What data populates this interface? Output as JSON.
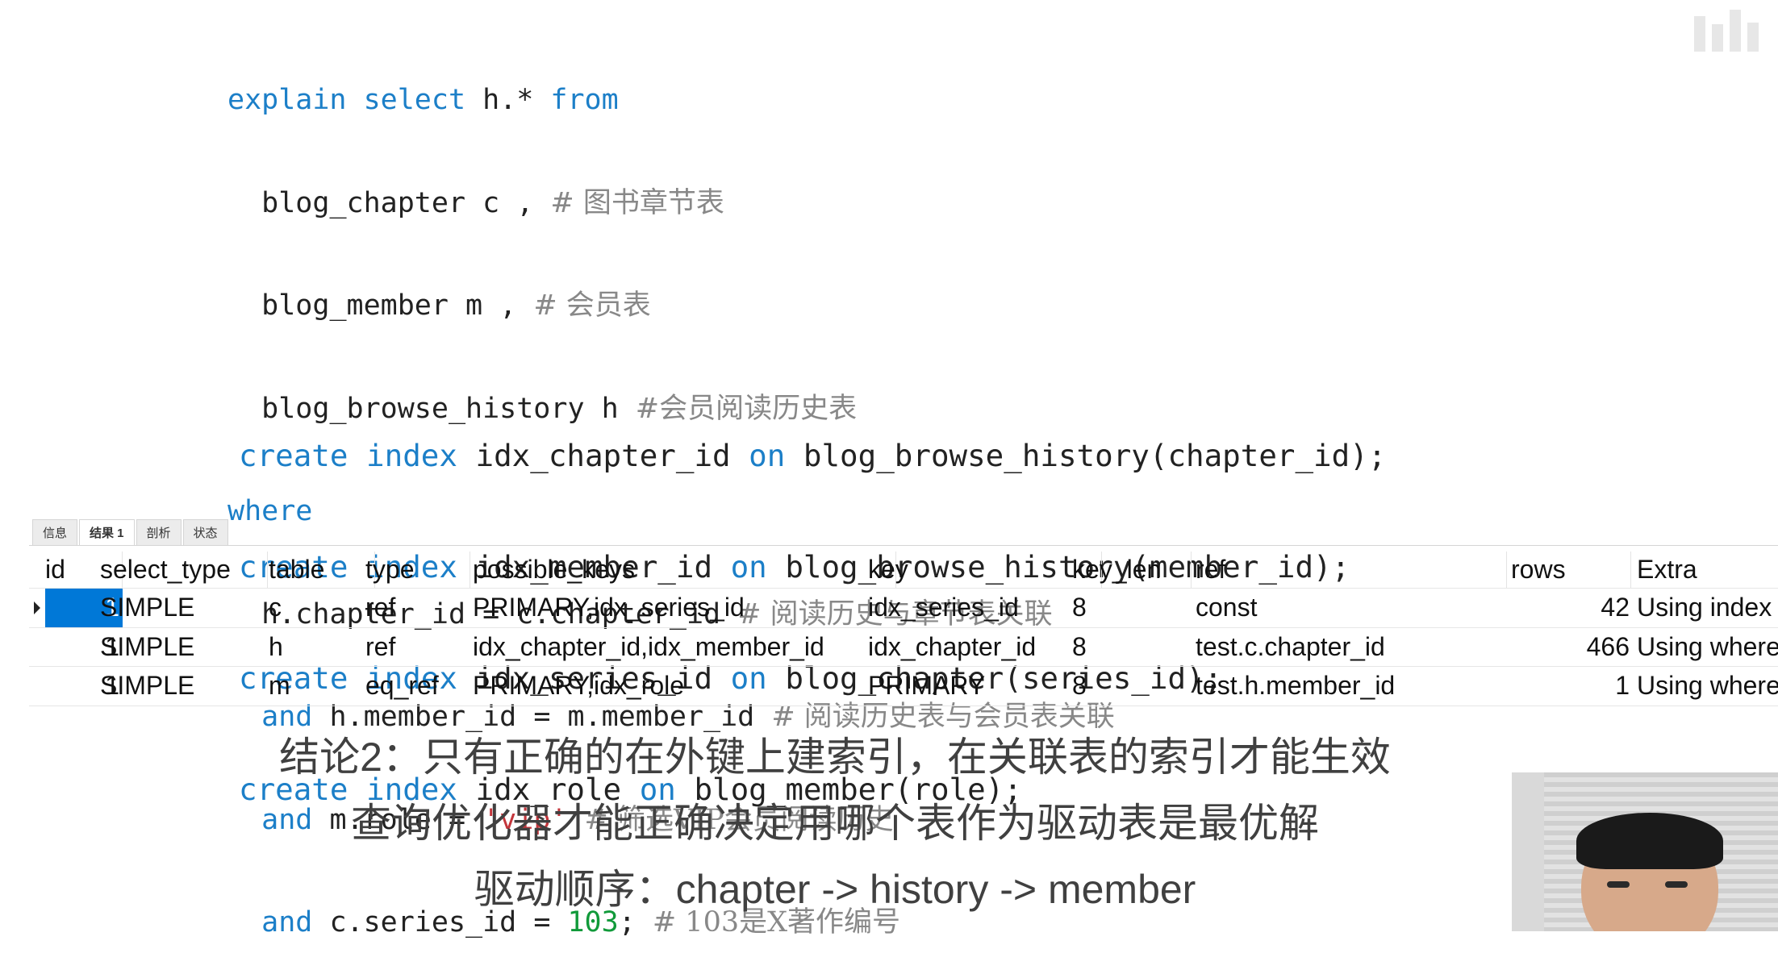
{
  "sql_explain": {
    "l1_kw1": "explain",
    "l1_kw2": "select",
    "l1_t1": "h.*",
    "l1_kw3": "from",
    "l2_code": "blog_chapter c ,",
    "l2_comment": "# 图书章节表",
    "l3_code": "blog_member m ,",
    "l3_comment": "# 会员表",
    "l4_code": "blog_browse_history h",
    "l4_comment": "#会员阅读历史表",
    "l5_kw": "where",
    "l6_code": "h.chapter_id = c.chapter_id",
    "l6_comment": "# 阅读历史与章节表关联",
    "l7_kw": "and",
    "l7_code": "h.member_id = m.member_id",
    "l7_comment": "# 阅读历史表与会员表关联",
    "l8_kw": "and",
    "l8_code": "m.role =",
    "l8_str": "'vip'",
    "l8_comment": "# 筛选VIP会员阅读历史",
    "l9_kw": "and",
    "l9_code": "c.series_id =",
    "l9_num": "103",
    "l9_semi": ";",
    "l9_comment": "# 103是X著作编号"
  },
  "sql_index": {
    "kw_create": "create",
    "kw_index": "index",
    "kw_on": "on",
    "lines": [
      {
        "name": "idx_chapter_id",
        "target": "blog_browse_history(chapter_id);"
      },
      {
        "name": "idx_member_id",
        "target": "blog_browse_history(member_id);"
      },
      {
        "name": "idx_series_id",
        "target": "blog_chapter(series_id);"
      },
      {
        "name": "idx_role",
        "target": "blog_member(role);"
      }
    ]
  },
  "tabs": [
    "信息",
    "结果 1",
    "剖析",
    "状态"
  ],
  "result": {
    "headers": {
      "id": "id",
      "select_type": "select_type",
      "table": "table",
      "type": "type",
      "possible_keys": "possible_keys",
      "key": "key",
      "key_len": "key_len",
      "ref": "ref",
      "rows": "rows",
      "extra": "Extra"
    },
    "rows": [
      {
        "id": "1",
        "select_type": "SIMPLE",
        "table": "c",
        "type": "ref",
        "possible_keys": "PRIMARY,idx_series_id",
        "key": "idx_series_id",
        "key_len": "8",
        "ref": "const",
        "rows": "42",
        "extra": "Using index"
      },
      {
        "id": "1",
        "select_type": "SIMPLE",
        "table": "h",
        "type": "ref",
        "possible_keys": "idx_chapter_id,idx_member_id",
        "key": "idx_chapter_id",
        "key_len": "8",
        "ref": "test.c.chapter_id",
        "rows": "466",
        "extra": "Using where"
      },
      {
        "id": "1",
        "select_type": "SIMPLE",
        "table": "m",
        "type": "eq_ref",
        "possible_keys": "PRIMARY,idx_role",
        "key": "PRIMARY",
        "key_len": "8",
        "ref": "test.h.member_id",
        "rows": "1",
        "extra": "Using where"
      }
    ]
  },
  "conclusion": {
    "line1": "结论2：只有正确的在外键上建索引，在关联表的索引才能生效",
    "line2": "查询优化器才能正确决定用哪个表作为驱动表是最优解",
    "line3": "驱动顺序：chapter -> history -> member"
  },
  "colors": {
    "keyword": "#1c7fc8",
    "comment": "#888888",
    "string": "#c4363c",
    "number": "#119a3a",
    "selection": "#0078d7"
  }
}
